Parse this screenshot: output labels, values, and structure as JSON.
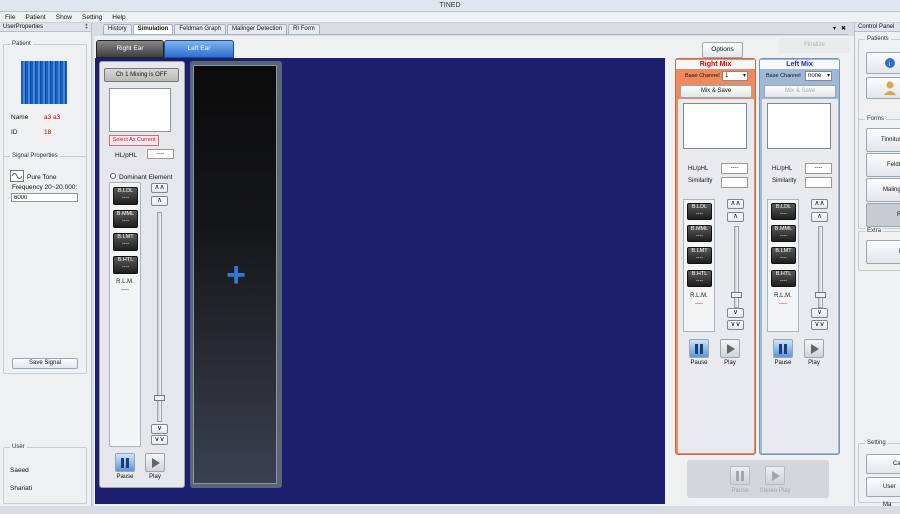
{
  "app": {
    "title": "TINED"
  },
  "menu": [
    "File",
    "Patient",
    "Show",
    "Setting",
    "Help"
  ],
  "left_panel": {
    "header": "UserProperties",
    "pin": "‡",
    "patient_group": "Patient",
    "name_label": "Name",
    "name_value": "a3 a3",
    "id_label": "ID",
    "id_value": "18",
    "signal_group": "Signal Properties",
    "signal_type": "Pure Tone",
    "freq_label": "Frequency 20~20.000:",
    "freq_value": "6000",
    "save_signal": "Save Signal",
    "user_group": "User",
    "user_first": "Saeed",
    "user_last": "Shariati"
  },
  "tabs": [
    "History",
    "Simulation",
    "Feldman Graph",
    "Malinger Detection",
    "RI Form"
  ],
  "active_tab": "Simulation",
  "close_glyph": "✖",
  "dropdown_glyph": "▾",
  "ear_tabs": [
    "Right Ear",
    "Left Ear"
  ],
  "channel": {
    "mixing": "Ch 1 Mixing is OFF",
    "select_current": "Select As Current",
    "hl_label": "HL/pHL",
    "hl_value": "----",
    "dominant": "Dominant Element",
    "elements": [
      {
        "label": "B.LDL",
        "value": "----"
      },
      {
        "label": "B.MML",
        "value": "----"
      },
      {
        "label": "B.LMT",
        "value": "----"
      },
      {
        "label": "B.HTL",
        "value": "----"
      }
    ],
    "rlm_label": "R.L.M.",
    "rlm_value": "----",
    "pause": "Pause",
    "play": "Play",
    "up_double": "∧∧",
    "up": "∧",
    "down": "∨",
    "down_double": "∨∨"
  },
  "plus_glyph": "+",
  "options_btn": "Options",
  "finalize_btn": "Finalize",
  "right_mix": {
    "title": "Right Mix",
    "base_label": "Base Channel",
    "base_value": "1",
    "mix_save": "Mix & Save",
    "hl_label": "HL/pHL",
    "hl_value": "----",
    "similarity_label": "Similarity",
    "elements": [
      "B.LDL",
      "B.MML",
      "B.LMT",
      "B.HTL"
    ],
    "element_value": "----",
    "rlm_label": "R.L.M.",
    "rlm_value": "----",
    "pause": "Pause",
    "play": "Play"
  },
  "left_mix": {
    "title": "Left Mix",
    "base_label": "Base Channel",
    "base_value": "none",
    "mix_save": "Mix & Save",
    "hl_label": "HL/pHL",
    "hl_value": "----",
    "similarity_label": "Similarity",
    "elements": [
      "B.LDL",
      "B.MML",
      "B.LMT",
      "B.HTL"
    ],
    "element_value": "----",
    "rlm_label": "R.L.M.",
    "rlm_value": "----",
    "pause": "Pause",
    "play": "Play"
  },
  "stereo": {
    "pause": "Pause",
    "play": "Stereo Play"
  },
  "control_panel": {
    "header": "Control Panel",
    "patients_group": "Patients",
    "forms_group": "Forms",
    "forms": [
      "Tinnitus",
      "Feldma",
      "Malinge",
      "RI"
    ],
    "extra_group": "Extra",
    "extra": [
      "Ra"
    ],
    "setting_group": "Setting",
    "setting": [
      "Calib",
      "User Ma"
    ]
  },
  "colors": {
    "workspace": "#1b1f6e",
    "right_mix_accent": "#f08a5d",
    "left_mix_accent": "#9fb8d8",
    "mix_title_red": "#d00000",
    "mix_title_blue": "#1a2cc0",
    "plus": "#2f7ad6"
  }
}
